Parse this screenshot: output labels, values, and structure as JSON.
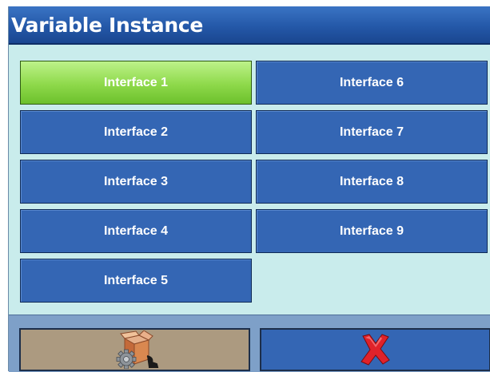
{
  "window": {
    "title": "Variable Instance"
  },
  "interfaces": [
    {
      "label": "Interface 1",
      "selected": true
    },
    {
      "label": "Interface 2",
      "selected": false
    },
    {
      "label": "Interface 3",
      "selected": false
    },
    {
      "label": "Interface 4",
      "selected": false
    },
    {
      "label": "Interface 5",
      "selected": false
    },
    {
      "label": "Interface 6",
      "selected": false
    },
    {
      "label": "Interface 7",
      "selected": false
    },
    {
      "label": "Interface 8",
      "selected": false
    },
    {
      "label": "Interface 9",
      "selected": false
    }
  ],
  "footer": {
    "setup_icon": "box-gear-icon",
    "cancel_icon": "red-x-icon"
  },
  "colors": {
    "title_bar": "#2458a8",
    "button_default": "#3466b4",
    "button_selected": "#8ed94a",
    "background": "#c9ecec",
    "cancel_x": "#e0222a"
  }
}
